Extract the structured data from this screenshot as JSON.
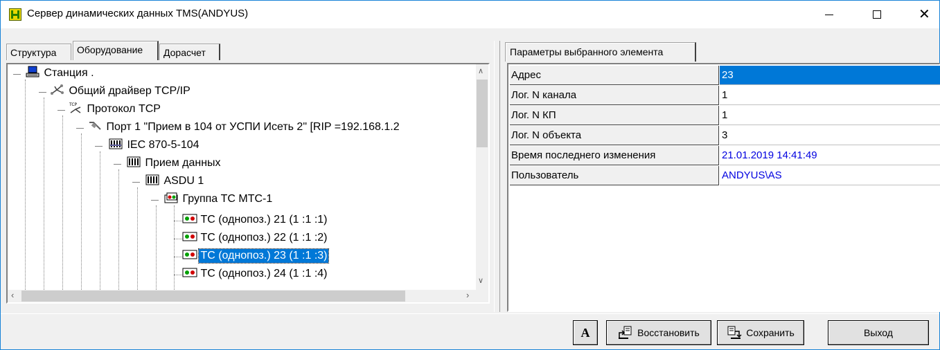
{
  "window": {
    "title": "Сервер динамических данных TMS(ANDYUS)",
    "controls": {
      "minimize": "—",
      "maximize": "☐",
      "close": "✕"
    }
  },
  "left_tabs": [
    {
      "label": "Структура",
      "active": false
    },
    {
      "label": "Оборудование",
      "active": true
    },
    {
      "label": "Дорасчет",
      "active": false
    }
  ],
  "tree": {
    "rows": [
      {
        "label": "Станция .",
        "icon": "computer-icon",
        "level": 0
      },
      {
        "label": "Общий драйвер TCP/IP",
        "icon": "network-icon",
        "level": 1
      },
      {
        "label": "Протокол TCP",
        "icon": "tcp-protocol-icon",
        "level": 2
      },
      {
        "label": "Порт 1 \"Прием в 104 от УСПИ Исеть 2\" [RIP =192.168.1.2",
        "icon": "plug-icon",
        "level": 3
      },
      {
        "label": "IEC 870-5-104",
        "icon": "iec-device-icon",
        "level": 4
      },
      {
        "label": "Прием данных",
        "icon": "data-receive-icon",
        "level": 5
      },
      {
        "label": "ASDU 1",
        "icon": "asdu-icon",
        "level": 6
      },
      {
        "label": "Группа ТС МТС-1",
        "icon": "group-icon",
        "level": 7
      },
      {
        "label": "ТС (однопоз.) 21 (1 :1 :1)",
        "icon": "ts-signal-icon",
        "level": 8
      },
      {
        "label": "ТС (однопоз.) 22 (1 :1 :2)",
        "icon": "ts-signal-icon",
        "level": 8
      },
      {
        "label": "ТС (однопоз.) 23 (1 :1 :3)",
        "icon": "ts-signal-icon",
        "level": 8,
        "selected": true
      },
      {
        "label": "ТС (однопоз.) 24 (1 :1 :4)",
        "icon": "ts-signal-icon",
        "level": 8
      }
    ]
  },
  "right_tab": {
    "label": "Параметры выбранного элемента"
  },
  "params": [
    {
      "key": "Адрес",
      "value": "23",
      "selected": true
    },
    {
      "key": "Лог. N канала",
      "value": "1"
    },
    {
      "key": "Лог. N КП",
      "value": "1"
    },
    {
      "key": "Лог. N объекта",
      "value": "3"
    },
    {
      "key": "Время последнего изменения",
      "value": "21.01.2019 14:41:49",
      "blue": true
    },
    {
      "key": "Пользователь",
      "value": "ANDYUS\\AS",
      "blue": true
    }
  ],
  "buttons": {
    "font": "A",
    "restore": "Восстановить",
    "save": "Сохранить",
    "exit": "Выход"
  },
  "colors": {
    "selection": "#0078d7",
    "value_blue": "#0000e0"
  }
}
